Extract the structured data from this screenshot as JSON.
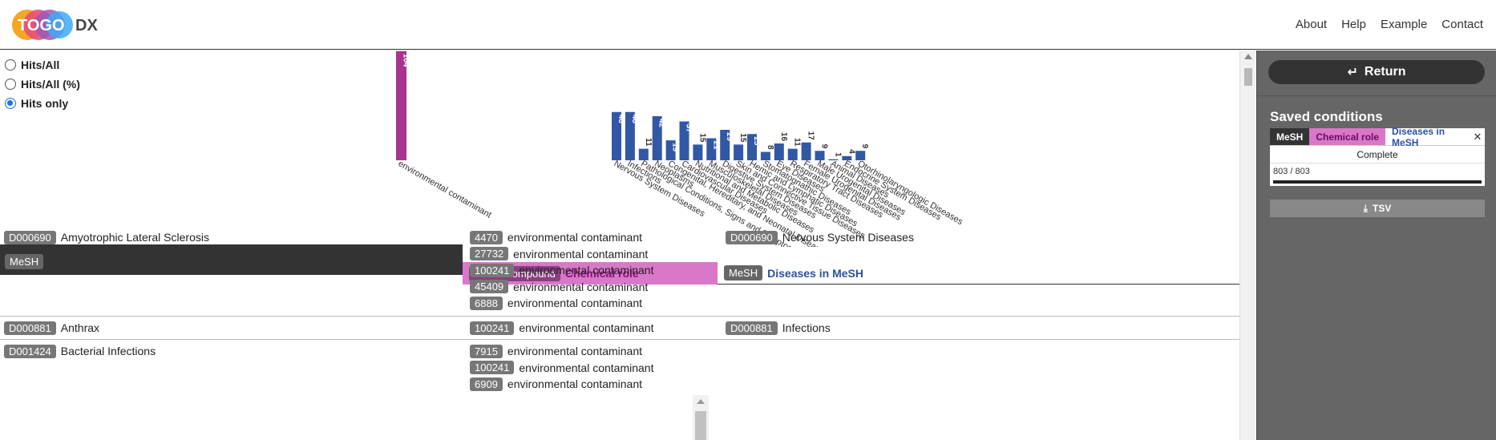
{
  "header": {
    "logo_text": "TOGO DX",
    "nav": [
      "About",
      "Help",
      "Example",
      "Contact"
    ]
  },
  "mode_options": [
    {
      "label": "Hits/All",
      "selected": false
    },
    {
      "label": "Hits/All (%)",
      "selected": false
    },
    {
      "label": "Hits only",
      "selected": true
    }
  ],
  "chart_data": [
    {
      "type": "bar",
      "color": "#a9338f",
      "categories": [
        "environmental contaminant"
      ],
      "values": [
        104
      ]
    },
    {
      "type": "bar",
      "color": "#3258a5",
      "categories": [
        "Nervous System Diseases",
        "Infections",
        "Pathological Conditions, Signs and Symptoms",
        "Neoplasms",
        "Congenital, Hereditary, and Neonatal Diseases and Abnormalities",
        "Cardiovascular Diseases",
        "Nutritional and Metabolic Diseases",
        "Musculoskeletal Diseases",
        "Digestive System Diseases",
        "Skin and Connective Tissue Diseases",
        "Hemic and Lymphatic Diseases",
        "Stomatognathic Diseases",
        "Eye Diseases",
        "Respiratory Tract Diseases",
        "Female Urogenital Diseases",
        "Male Urogenital Diseases",
        "Animal Diseases",
        "Endocrine System Diseases",
        "Otorhinolaryngologic Diseases"
      ],
      "values": [
        46,
        46,
        11,
        42,
        19,
        37,
        15,
        21,
        29,
        15,
        25,
        8,
        16,
        11,
        17,
        9,
        1,
        4,
        9
      ],
      "label_values": [
        "46",
        "46",
        "11",
        "42",
        "19",
        "37",
        "15",
        "21",
        "29",
        "15",
        "25",
        "8",
        "16",
        "11",
        "17",
        "9",
        "1",
        "4",
        "9"
      ]
    }
  ],
  "columns": {
    "mesh_tag": "MeSH",
    "chem_tag": "ChEBI compound",
    "chem_label": "Chemical role",
    "dis_tag": "MeSH",
    "dis_label": "Diseases in MeSH"
  },
  "rows": [
    {
      "mesh_id": "D000690",
      "mesh_name": "Amyotrophic Lateral Sclerosis",
      "chem": [
        {
          "id": "4470",
          "role": "environmental contaminant"
        },
        {
          "id": "27732",
          "role": "environmental contaminant"
        },
        {
          "id": "100241",
          "role": "environmental contaminant"
        },
        {
          "id": "45409",
          "role": "environmental contaminant"
        },
        {
          "id": "6888",
          "role": "environmental contaminant"
        }
      ],
      "dis": {
        "id": "D000690",
        "name": "Nervous System Diseases"
      }
    },
    {
      "mesh_id": "D000881",
      "mesh_name": "Anthrax",
      "chem": [
        {
          "id": "100241",
          "role": "environmental contaminant"
        }
      ],
      "dis": {
        "id": "D000881",
        "name": "Infections"
      }
    },
    {
      "mesh_id": "D001424",
      "mesh_name": "Bacterial Infections",
      "chem": [
        {
          "id": "7915",
          "role": "environmental contaminant"
        },
        {
          "id": "100241",
          "role": "environmental contaminant"
        },
        {
          "id": "6909",
          "role": "environmental contaminant"
        }
      ],
      "dis": null
    }
  ],
  "side": {
    "return_label": "Return",
    "saved_title": "Saved conditions",
    "card_tags": {
      "mesh": "MeSH",
      "chem": "Chemical role",
      "dis": "Diseases in MeSH"
    },
    "status": "Complete",
    "progress_text": "803 / 803",
    "progress": 1.0,
    "tsv_label": "TSV"
  }
}
